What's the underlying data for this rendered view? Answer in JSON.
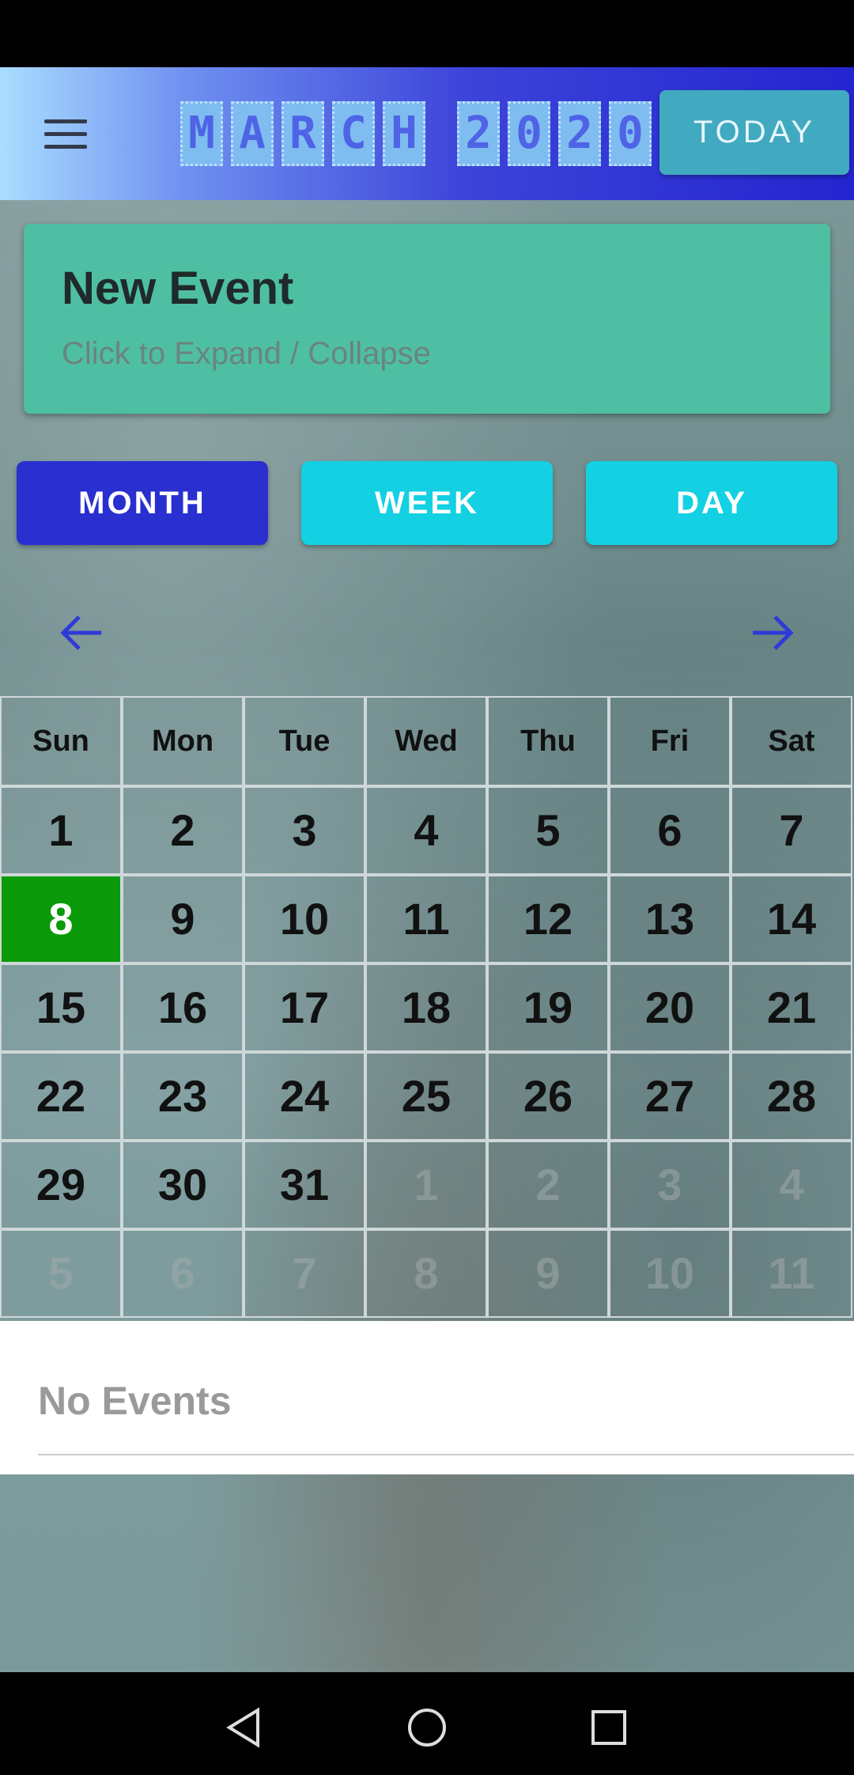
{
  "header": {
    "title_letters": [
      "M",
      "A",
      "R",
      "C",
      "H",
      "2",
      "0",
      "2",
      "0"
    ],
    "today_label": "TODAY",
    "menu_icon": "hamburger-menu-icon"
  },
  "event_card": {
    "title": "New Event",
    "subtitle": "Click to Expand / Collapse"
  },
  "view_tabs": [
    {
      "label": "MONTH",
      "active": true
    },
    {
      "label": "WEEK",
      "active": false
    },
    {
      "label": "DAY",
      "active": false
    }
  ],
  "navigation": {
    "prev_icon": "arrow-left-icon",
    "next_icon": "arrow-right-icon"
  },
  "calendar": {
    "weekdays": [
      "Sun",
      "Mon",
      "Tue",
      "Wed",
      "Thu",
      "Fri",
      "Sat"
    ],
    "weeks": [
      [
        "1",
        "2",
        "3",
        "4",
        "5",
        "6",
        "7"
      ],
      [
        "8",
        "9",
        "10",
        "11",
        "12",
        "13",
        "14"
      ],
      [
        "15",
        "16",
        "17",
        "18",
        "19",
        "20",
        "21"
      ],
      [
        "22",
        "23",
        "24",
        "25",
        "26",
        "27",
        "28"
      ],
      [
        "29",
        "30",
        "31",
        "1",
        "2",
        "3",
        "4"
      ],
      [
        "5",
        "6",
        "7",
        "8",
        "9",
        "10",
        "11"
      ]
    ],
    "selected_day": "8",
    "selected_color": "#0a9a0a"
  },
  "events_panel": {
    "empty_text": "No Events"
  },
  "colors": {
    "accent_blue": "#2a2fd0",
    "accent_cyan": "#13d0e3",
    "event_card": "#4fbfa3"
  }
}
